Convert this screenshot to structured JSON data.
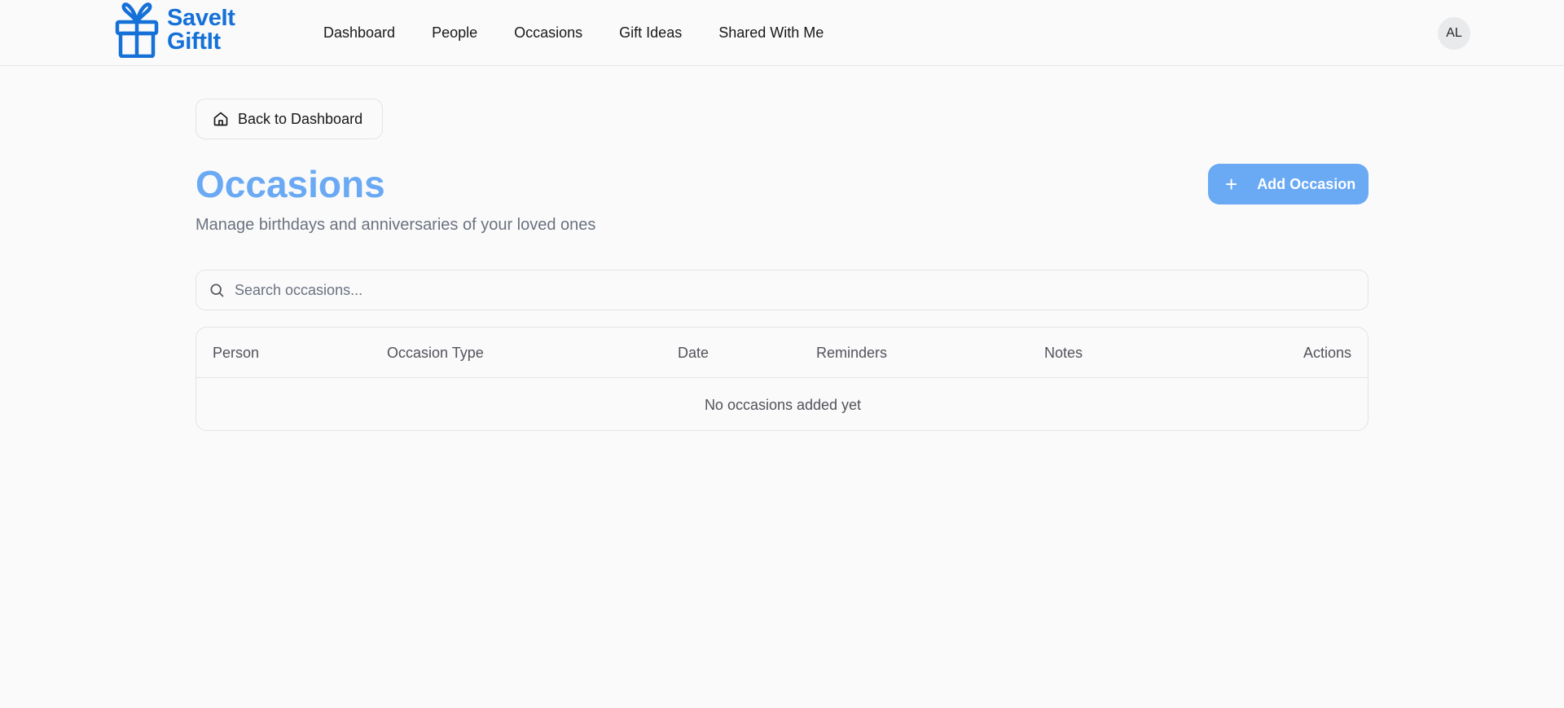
{
  "brand": {
    "line1": "SaveIt",
    "line2": "GiftIt",
    "color": "#1570d8"
  },
  "nav": {
    "items": [
      {
        "label": "Dashboard"
      },
      {
        "label": "People"
      },
      {
        "label": "Occasions"
      },
      {
        "label": "Gift Ideas"
      },
      {
        "label": "Shared With Me"
      }
    ]
  },
  "user": {
    "initials": "AL"
  },
  "back": {
    "label": "Back to Dashboard",
    "icon": "home-icon"
  },
  "page": {
    "title": "Occasions",
    "subtitle": "Manage birthdays and anniversaries of your loved ones",
    "accent": "#6aa9f3"
  },
  "actions": {
    "add_label": "Add Occasion",
    "icon": "plus-icon"
  },
  "search": {
    "placeholder": "Search occasions...",
    "value": "",
    "icon": "search-icon"
  },
  "table": {
    "columns": [
      "Person",
      "Occasion Type",
      "Date",
      "Reminders",
      "Notes",
      "Actions"
    ],
    "rows": [],
    "empty_text": "No occasions added yet"
  }
}
